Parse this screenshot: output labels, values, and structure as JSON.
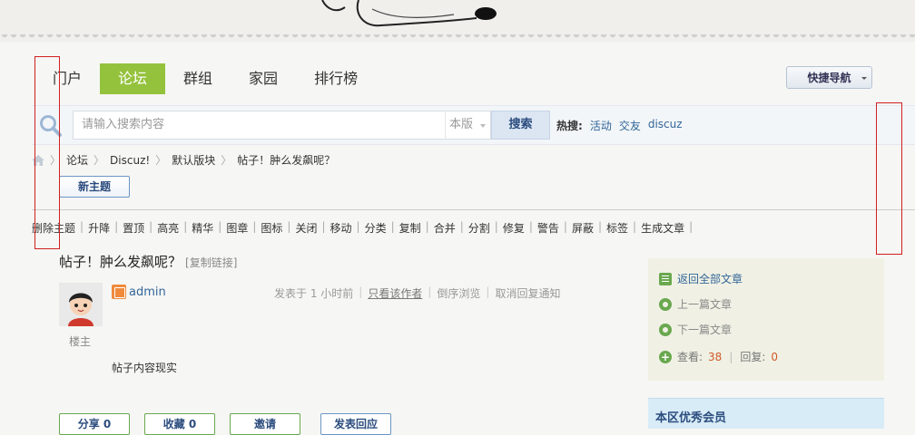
{
  "nav": {
    "items": [
      {
        "label": "门户",
        "active": false
      },
      {
        "label": "论坛",
        "active": true
      },
      {
        "label": "群组",
        "active": false
      },
      {
        "label": "家园",
        "active": false
      },
      {
        "label": "排行榜",
        "active": false
      }
    ],
    "quick_nav_label": "快捷导航"
  },
  "search": {
    "placeholder": "请输入搜索内容",
    "scope": "本版",
    "button": "搜索",
    "hot_label": "热搜:",
    "hot_terms": [
      "活动",
      "交友",
      "discuz"
    ]
  },
  "breadcrumb": [
    "论坛",
    "Discuz!",
    "默认版块",
    "帖子！肿么发飙呢？"
  ],
  "new_thread_label": "新主题",
  "mod_actions": [
    "删除主题",
    "升降",
    "置顶",
    "高亮",
    "精华",
    "图章",
    "图标",
    "关闭",
    "移动",
    "分类",
    "复制",
    "合并",
    "分割",
    "修复",
    "警告",
    "屏蔽",
    "标签",
    "生成文章"
  ],
  "thread": {
    "title": "帖子！肿么发飙呢？",
    "copy_link": "[复制链接]",
    "author": "admin",
    "role": "楼主",
    "posted": "发表于 1 小时前",
    "only_author": "只看该作者",
    "reverse": "倒序浏览",
    "cancel_notify": "取消回复通知",
    "content": "帖子内容现实"
  },
  "sidebar": {
    "back_all": "返回全部文章",
    "prev": "上一篇文章",
    "next": "下一篇文章",
    "views_label": "查看:",
    "views": "38",
    "replies_label": "回复:",
    "replies": "0",
    "members_title": "本区优秀会员"
  },
  "post_actions": [
    "分享 0",
    "收藏 0",
    "邀请"
  ],
  "reply_label": "发表回应",
  "colors": {
    "accent": "#94c23c",
    "link": "#336699",
    "highlight": "#d02020"
  }
}
